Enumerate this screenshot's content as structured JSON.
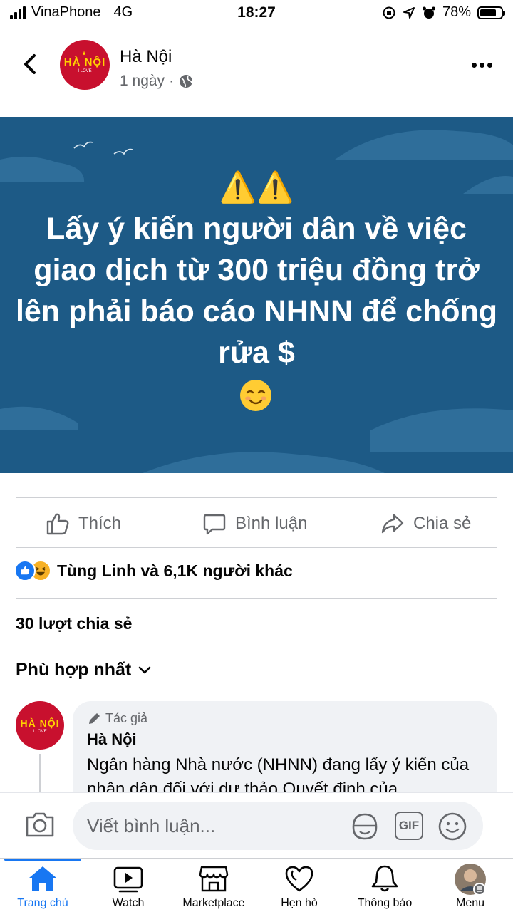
{
  "status_bar": {
    "carrier": "VinaPhone",
    "network": "4G",
    "time": "18:27",
    "battery": "78%",
    "battery_level": 0.78
  },
  "header": {
    "page_name": "Hà Nội",
    "post_time": "1 ngày",
    "separator": "·",
    "avatar_line1": "HÀ NỘI",
    "avatar_line2": "I LOVE"
  },
  "post": {
    "warning_emoji": "⚠️⚠️",
    "headline": "Lấy ý kiến người dân về việc giao dịch từ 300 triệu đồng trở lên phải báo cáo NHNN để chống rửa $",
    "background_color": "#1d5a86"
  },
  "actions": {
    "like": "Thích",
    "comment": "Bình luận",
    "share": "Chia sẻ"
  },
  "reactions": {
    "summary": "Tùng Linh và 6,1K người khác"
  },
  "shares": {
    "count_text": "30 lượt chia sẻ"
  },
  "comments_sort": {
    "label": "Phù hợp nhất"
  },
  "comment": {
    "author_badge": "Tác giả",
    "author": "Hà Nội",
    "avatar_line1": "HÀ NỘI",
    "avatar_line2": "I LOVE",
    "text": "Ngân hàng Nhà nước (NHNN) đang lấy ý kiến của nhân dân đối với dự thảo Quyết định của"
  },
  "composer": {
    "placeholder": "Viết bình luận...",
    "gif": "GIF"
  },
  "tabbar": {
    "tabs": [
      {
        "label": "Trang chủ"
      },
      {
        "label": "Watch"
      },
      {
        "label": "Marketplace"
      },
      {
        "label": "Hẹn hò"
      },
      {
        "label": "Thông báo"
      },
      {
        "label": "Menu"
      }
    ],
    "accent": "#1877f2"
  }
}
